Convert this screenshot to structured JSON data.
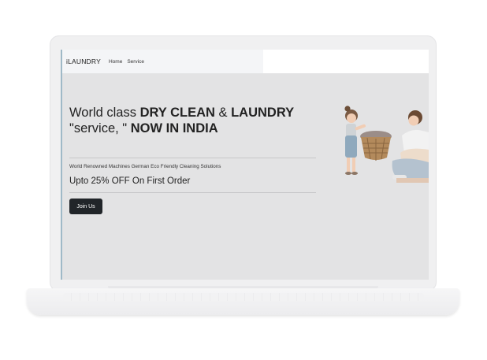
{
  "nav": {
    "brand": "iLAUNDRY",
    "links": [
      "Home",
      "Service"
    ]
  },
  "hero": {
    "title_part1": "World class ",
    "title_bold1": "DRY CLEAN",
    "title_part2": " & ",
    "title_bold2": "LAUNDRY",
    "title_part3": " \"service, \" ",
    "title_bold3": "NOW IN INDIA",
    "tagline": "World Renowned Machines German Eco Friendly Cleaning Solutions",
    "offer": "Upto 25% OFF On First Order",
    "cta_label": "Join Us",
    "illustration": "mother-and-child-laundry-basket-photo"
  },
  "colors": {
    "page_bg": "#e3e3e4",
    "nav_bg": "#f4f5f7",
    "button_bg": "#212529",
    "text": "#222222"
  }
}
